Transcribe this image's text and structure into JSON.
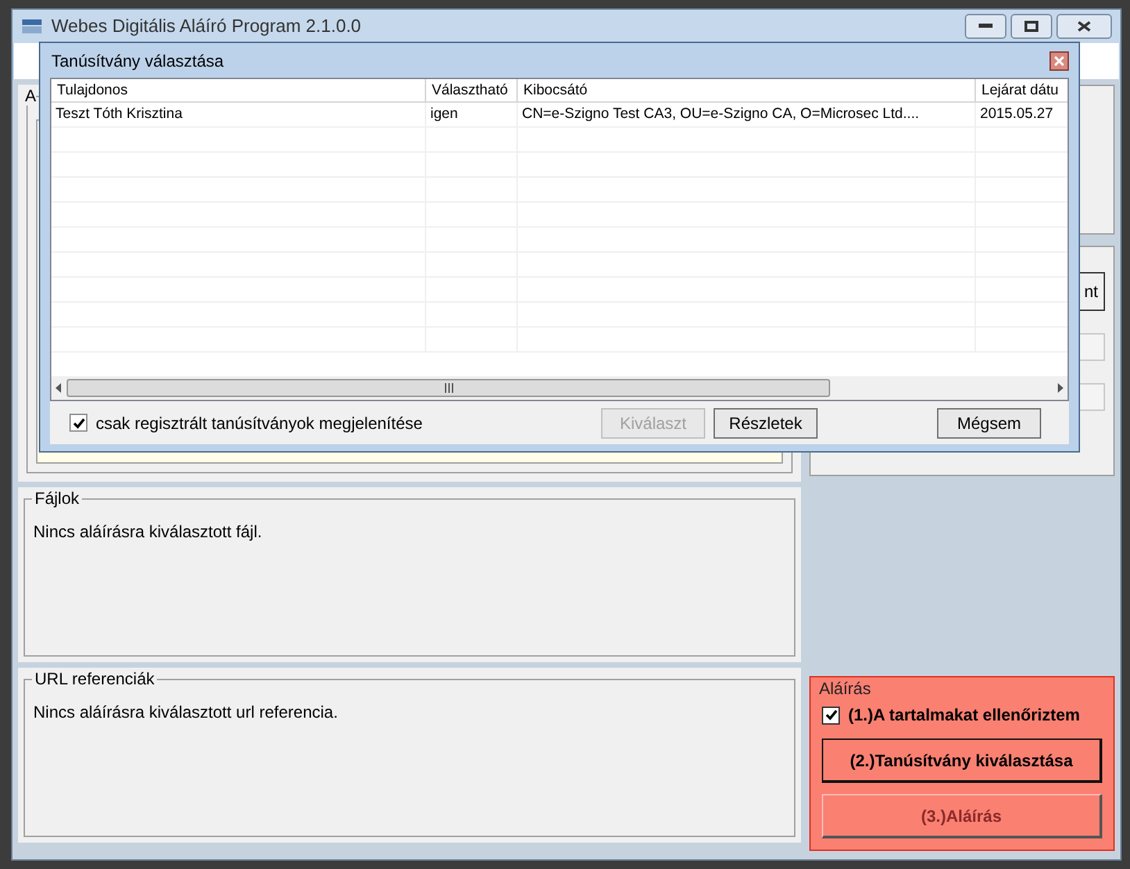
{
  "window": {
    "title": "Webes Digitális Aláíró Program 2.1.0.0"
  },
  "main": {
    "top_group_title": "A",
    "right_button": "nt"
  },
  "files": {
    "title": "Fájlok",
    "message": "Nincs aláírásra kiválasztott fájl."
  },
  "urls": {
    "title": "URL referenciák",
    "message": "Nincs aláírásra kiválasztott url referencia."
  },
  "signing": {
    "title": "Aláírás",
    "confirm": {
      "label": "(1.)A tartalmakat ellenőriztem",
      "checked": true
    },
    "buttons": [
      {
        "label": "(2.)Tanúsítvány kiválasztása",
        "disabled": false
      },
      {
        "label": "(3.)Aláírás",
        "disabled": true
      }
    ]
  },
  "dialog": {
    "title": "Tanúsítvány választása",
    "table": {
      "columns": [
        "Tulajdonos",
        "Választható",
        "Kibocsátó",
        "Lejárat dátu"
      ],
      "rows": [
        [
          "Teszt Tóth Krisztina",
          "igen",
          "CN=e-Szigno Test CA3, OU=e-Szigno CA, O=Microsec Ltd....",
          "2015.05.27"
        ]
      ]
    },
    "filter": {
      "label": "csak regisztrált tanúsítványok megjelenítése",
      "checked": true
    },
    "buttons": [
      {
        "label": "Kiválaszt",
        "disabled": true
      },
      {
        "label": "Részletek",
        "disabled": false
      },
      {
        "label": "Mégsem",
        "disabled": false
      }
    ]
  }
}
